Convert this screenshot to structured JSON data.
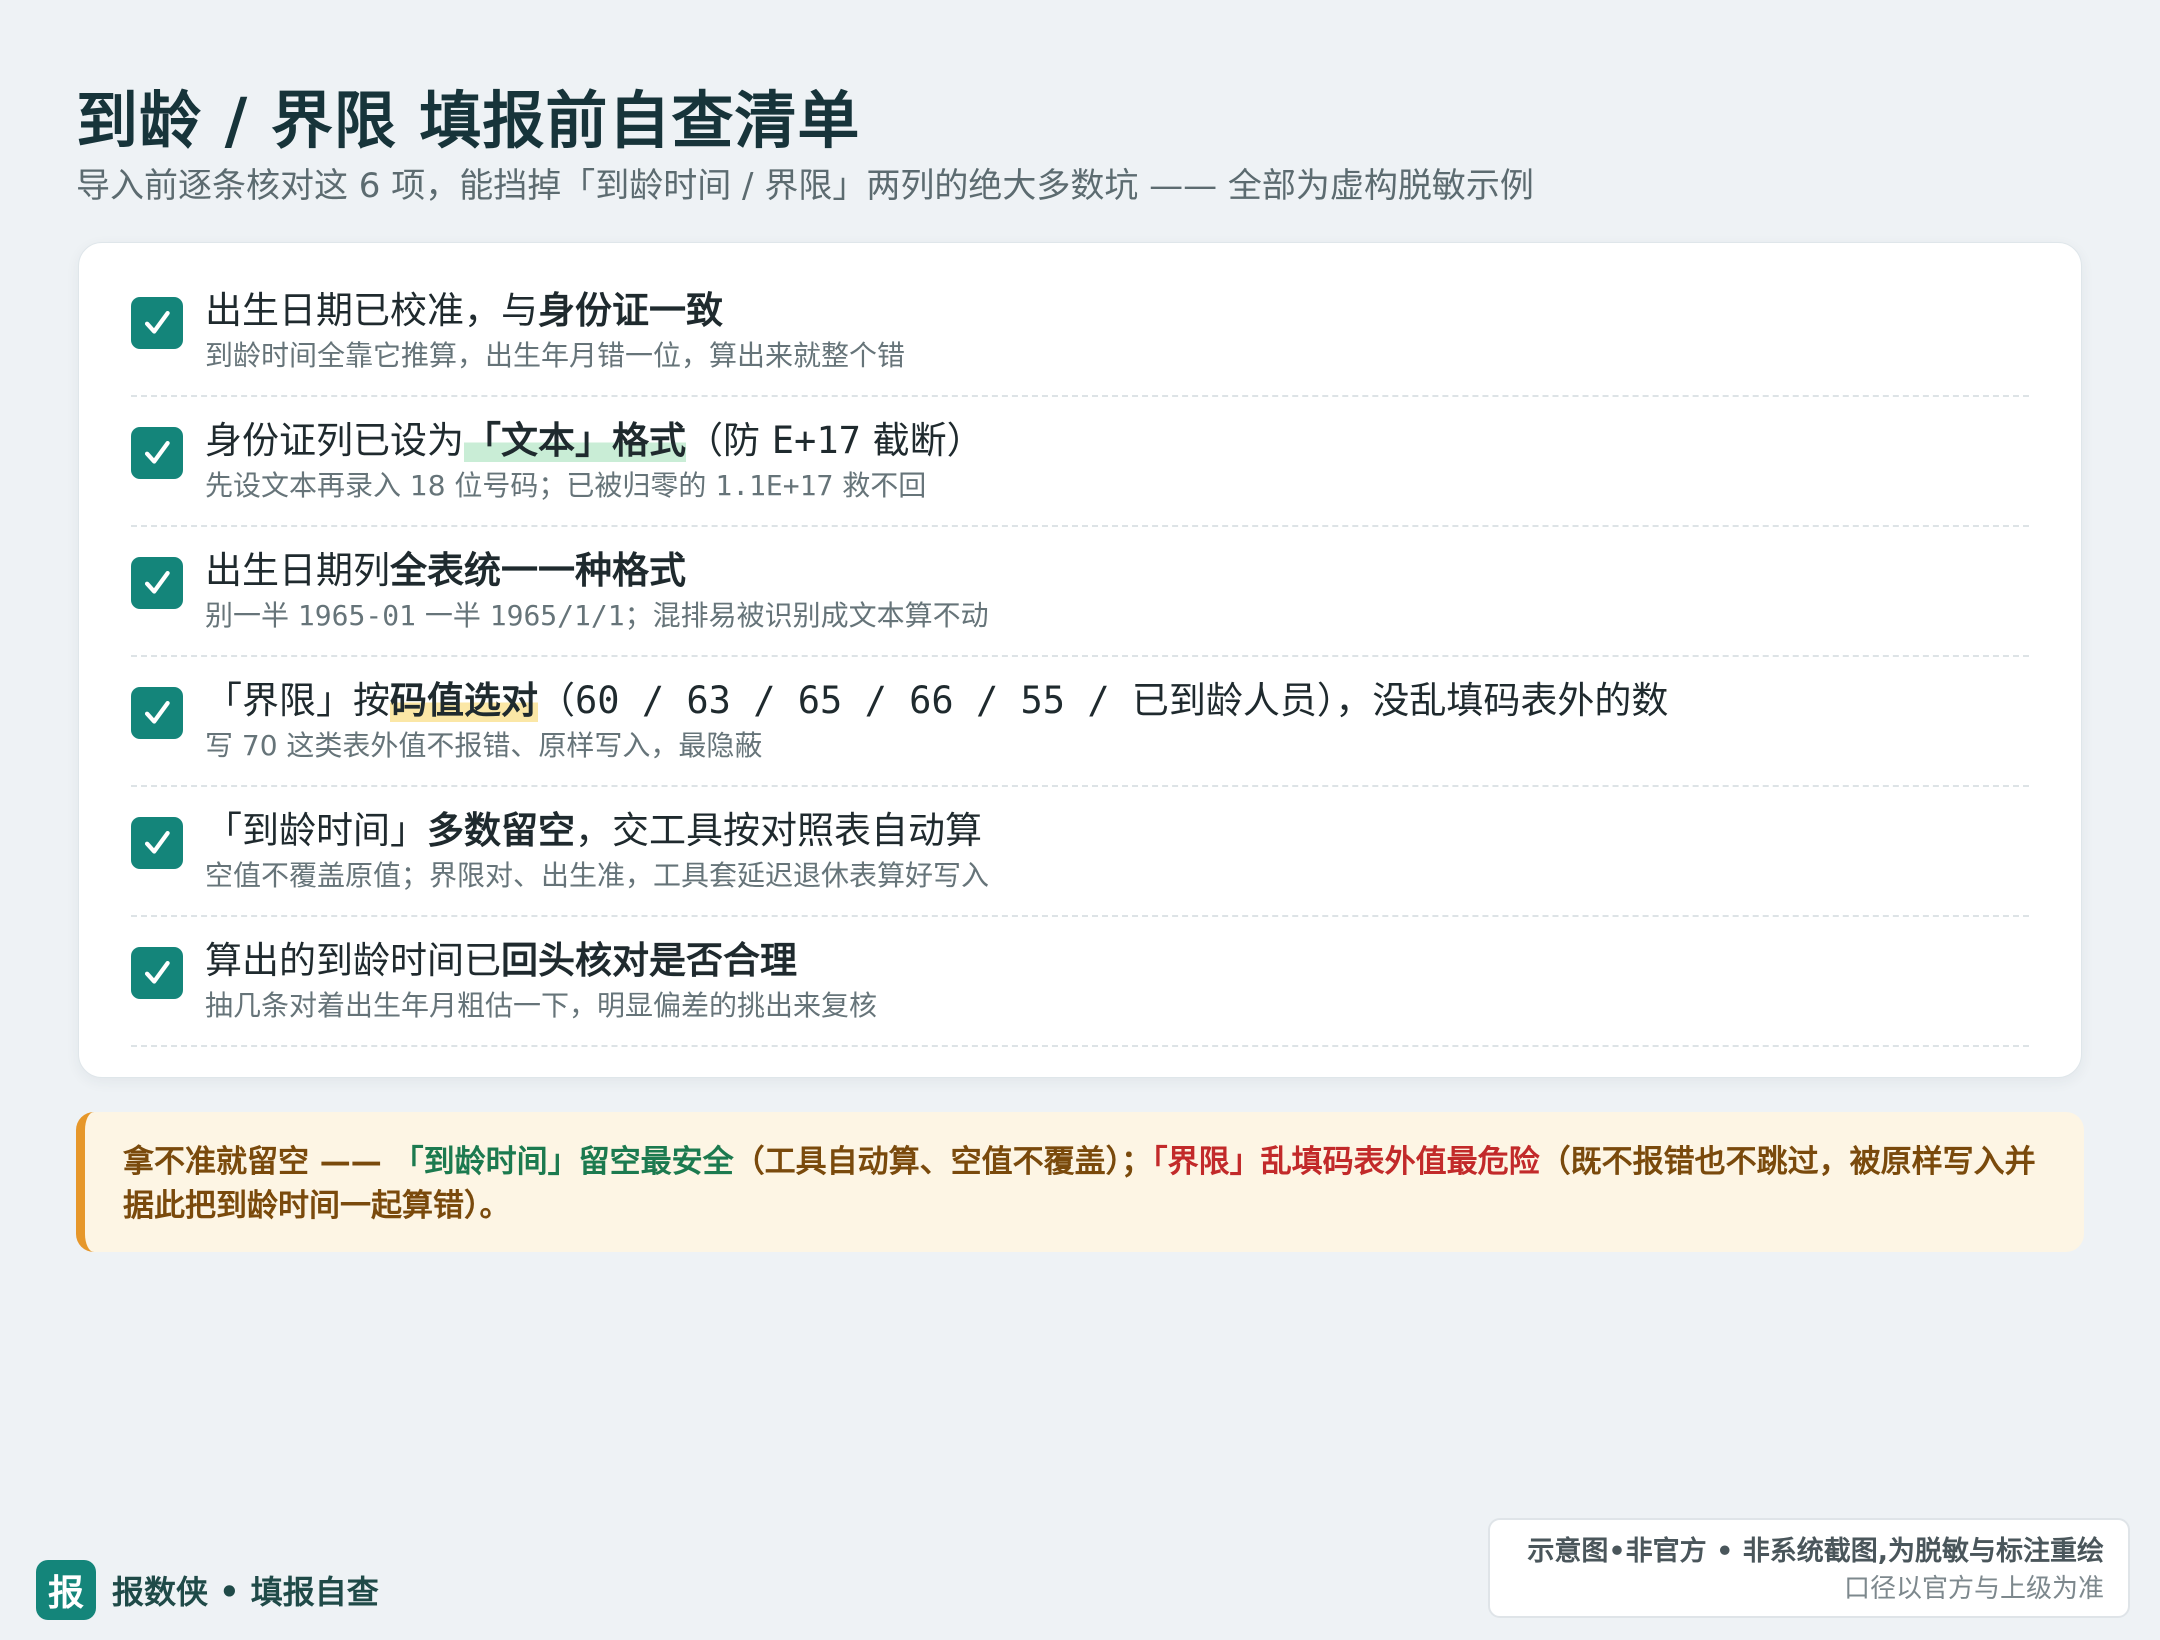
{
  "header": {
    "title": "到龄 / 界限 填报前自查清单",
    "subtitle": "导入前逐条核对这 6 项，能挡掉「到龄时间 / 界限」两列的绝大多数坑 —— 全部为虚构脱敏示例"
  },
  "checklist": [
    {
      "checked": true,
      "main": {
        "pre": "出生日期已校准，与",
        "bold": "身份证一致"
      },
      "sub": "到龄时间全靠它推算，出生年月错一位，算出来就整个错"
    },
    {
      "checked": true,
      "main": {
        "pre": "身份证列已设为",
        "bold": "「文本」格式",
        "post": "（防 ",
        "code": "E+17",
        "post2": " 截断）"
      },
      "sub": {
        "pre": "先设文本再录入 18 位号码；已被归零的 ",
        "code": "1.1E+17",
        "post": " 救不回"
      }
    },
    {
      "checked": true,
      "main": {
        "pre": "出生日期列",
        "bold": "全表统一一种格式"
      },
      "sub": {
        "pre": "别一半 ",
        "code1": "1965-01",
        "mid": " 一半 ",
        "code2": "1965/1/1",
        "post": "；混排易被识别成文本算不动"
      }
    },
    {
      "checked": true,
      "main": {
        "pre": "「界限」按",
        "bold": "码值选对",
        "code": "（60 / 63 / 65 / 66 / 55 / 已到龄人员），",
        "post": "没乱填码表外的数"
      },
      "sub": "写 70 这类表外值不报错、原样写入，最隐蔽"
    },
    {
      "checked": true,
      "main": {
        "pre": "「到龄时间」",
        "bold": "多数留空",
        "post": "，交工具按对照表自动算"
      },
      "sub": "空值不覆盖原值；界限对、出生准，工具套延迟退休表算好写入"
    },
    {
      "checked": true,
      "main": {
        "pre": "算出的到龄时间已",
        "bold": "回头核对是否合理"
      },
      "sub": "抽几条对着出生年月粗估一下，明显偏差的挑出来复核"
    }
  ],
  "warning": {
    "lead": "拿不准就留空 —— ",
    "green": "「到龄时间」留空最安全",
    "mid": "（工具自动算、空值不覆盖）；",
    "red": "「界限」乱填码表外值最危险",
    "tail": "（既不报错也不跳过，被原样写入并据此把到龄时间一起算错）。"
  },
  "brand": {
    "logo_char": "报",
    "name": "报数侠 • 填报自查"
  },
  "disclaimer": {
    "line1": "示意图•非官方 • 非系统截图,为脱敏与标注重绘",
    "line2": "口径以官方与上级为准"
  },
  "colors": {
    "accent": "#14857a",
    "warning_border": "#e6972a",
    "safe_green": "#1c7a4f",
    "danger_red": "#c22a2a"
  }
}
